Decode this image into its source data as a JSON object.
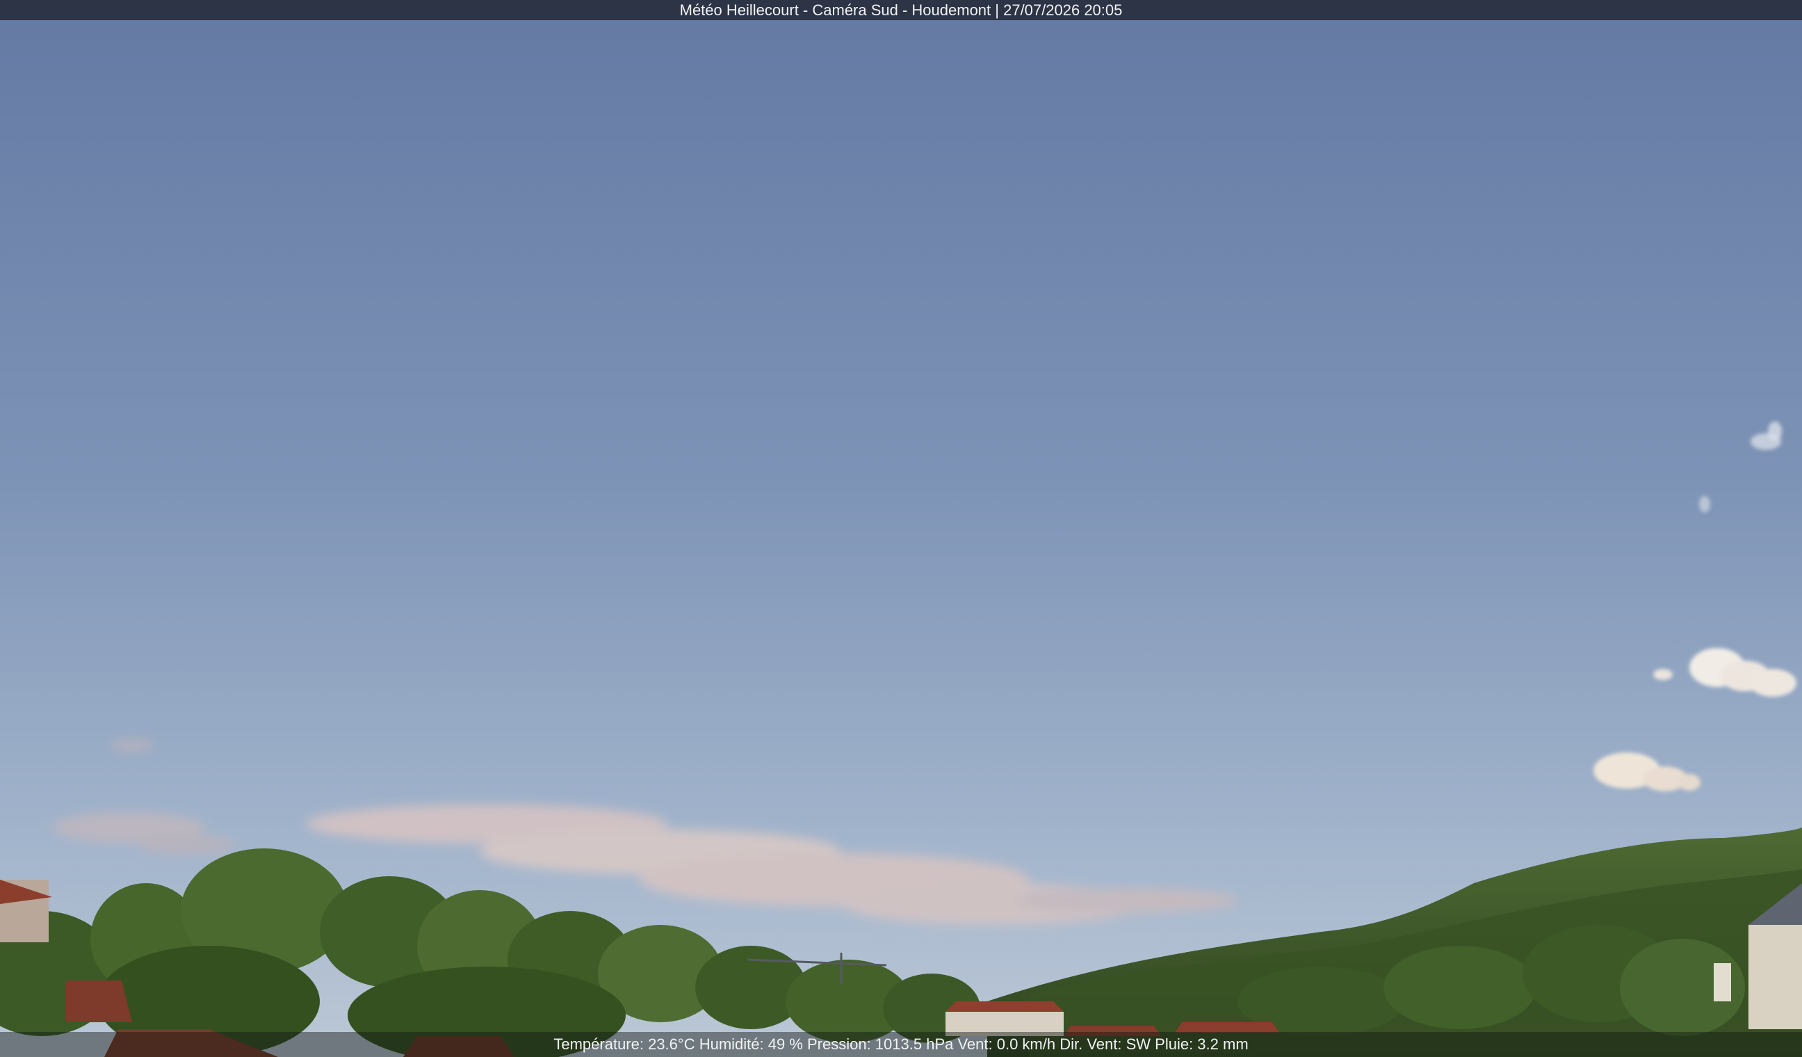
{
  "overlay": {
    "title": "Météo Heillecourt - Caméra Sud - Houdemont | 27/07/2026 20:05",
    "readings": "Température: 23.6°C  Humidité: 49 % Pression: 1013.5 hPa Vent: 0.0 km/h Dir. Vent: SW Pluie: 3.2 mm"
  },
  "colors": {
    "sky_top": "#6479a3",
    "sky_bottom": "#b4c3d6",
    "foliage": "#3f5a26",
    "roofs": "#8c3e2c"
  }
}
